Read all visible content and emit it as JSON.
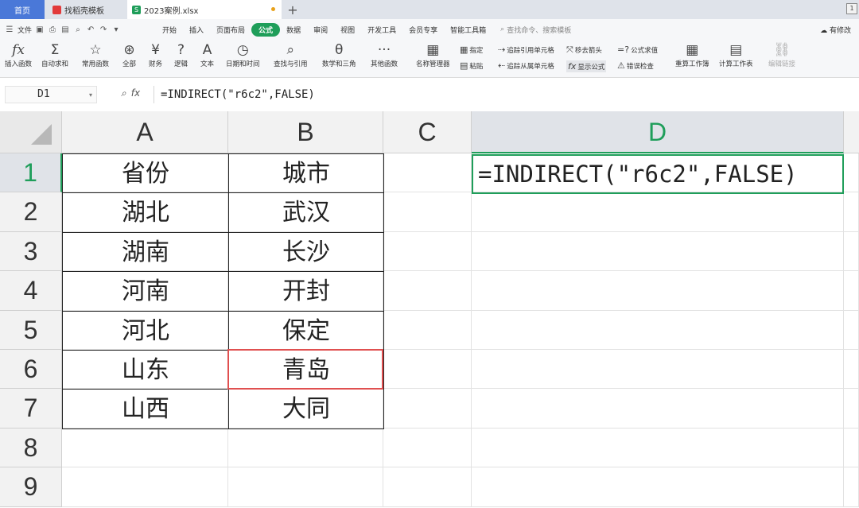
{
  "tabs": {
    "home": "首页",
    "template": "找稻壳模板",
    "file": "2023案例.xlsx",
    "new_tab": "+"
  },
  "menu": {
    "file": "文件",
    "items": [
      "开始",
      "插入",
      "页面布局",
      "公式",
      "数据",
      "审阅",
      "视图",
      "开发工具",
      "会员专享",
      "智能工具箱"
    ],
    "active": "公式",
    "search_placeholder": "查找命令、搜索模板",
    "modified": "有修改"
  },
  "ribbon": {
    "insert_function": "插入函数",
    "autosum": "自动求和",
    "common": "常用函数",
    "all": "全部",
    "finance": "财务",
    "logic": "逻辑",
    "text": "文本",
    "datetime": "日期和时间",
    "lookup": "查找与引用",
    "math": "数学和三角",
    "other": "其他函数",
    "name_manager": "名称管理器",
    "specify": "指定",
    "paste": "粘贴",
    "trace_precedents": "追踪引用单元格",
    "trace_dependents": "追踪从属单元格",
    "remove_arrows": "移去箭头",
    "evaluate": "公式求值",
    "show_formulas": "显示公式",
    "error_check": "错误检查",
    "recalc_book": "重算工作簿",
    "calc_sheet": "计算工作表",
    "edit_links": "编辑链接"
  },
  "formula_bar": {
    "name_box": "D1",
    "formula": "=INDIRECT(\"r6c2\",FALSE)"
  },
  "sheet": {
    "columns": [
      "A",
      "B",
      "C",
      "D"
    ],
    "rows": [
      "1",
      "2",
      "3",
      "4",
      "5",
      "6",
      "7",
      "8",
      "9"
    ],
    "table": [
      [
        "省份",
        "城市"
      ],
      [
        "湖北",
        "武汉"
      ],
      [
        "湖南",
        "长沙"
      ],
      [
        "河南",
        "开封"
      ],
      [
        "河北",
        "保定"
      ],
      [
        "山东",
        "青岛"
      ],
      [
        "山西",
        "大同"
      ]
    ],
    "active_cell_content": "=INDIRECT(\"r6c2\",FALSE)",
    "accent_color": "#1f9e5a",
    "highlight_color": "#e05050"
  }
}
